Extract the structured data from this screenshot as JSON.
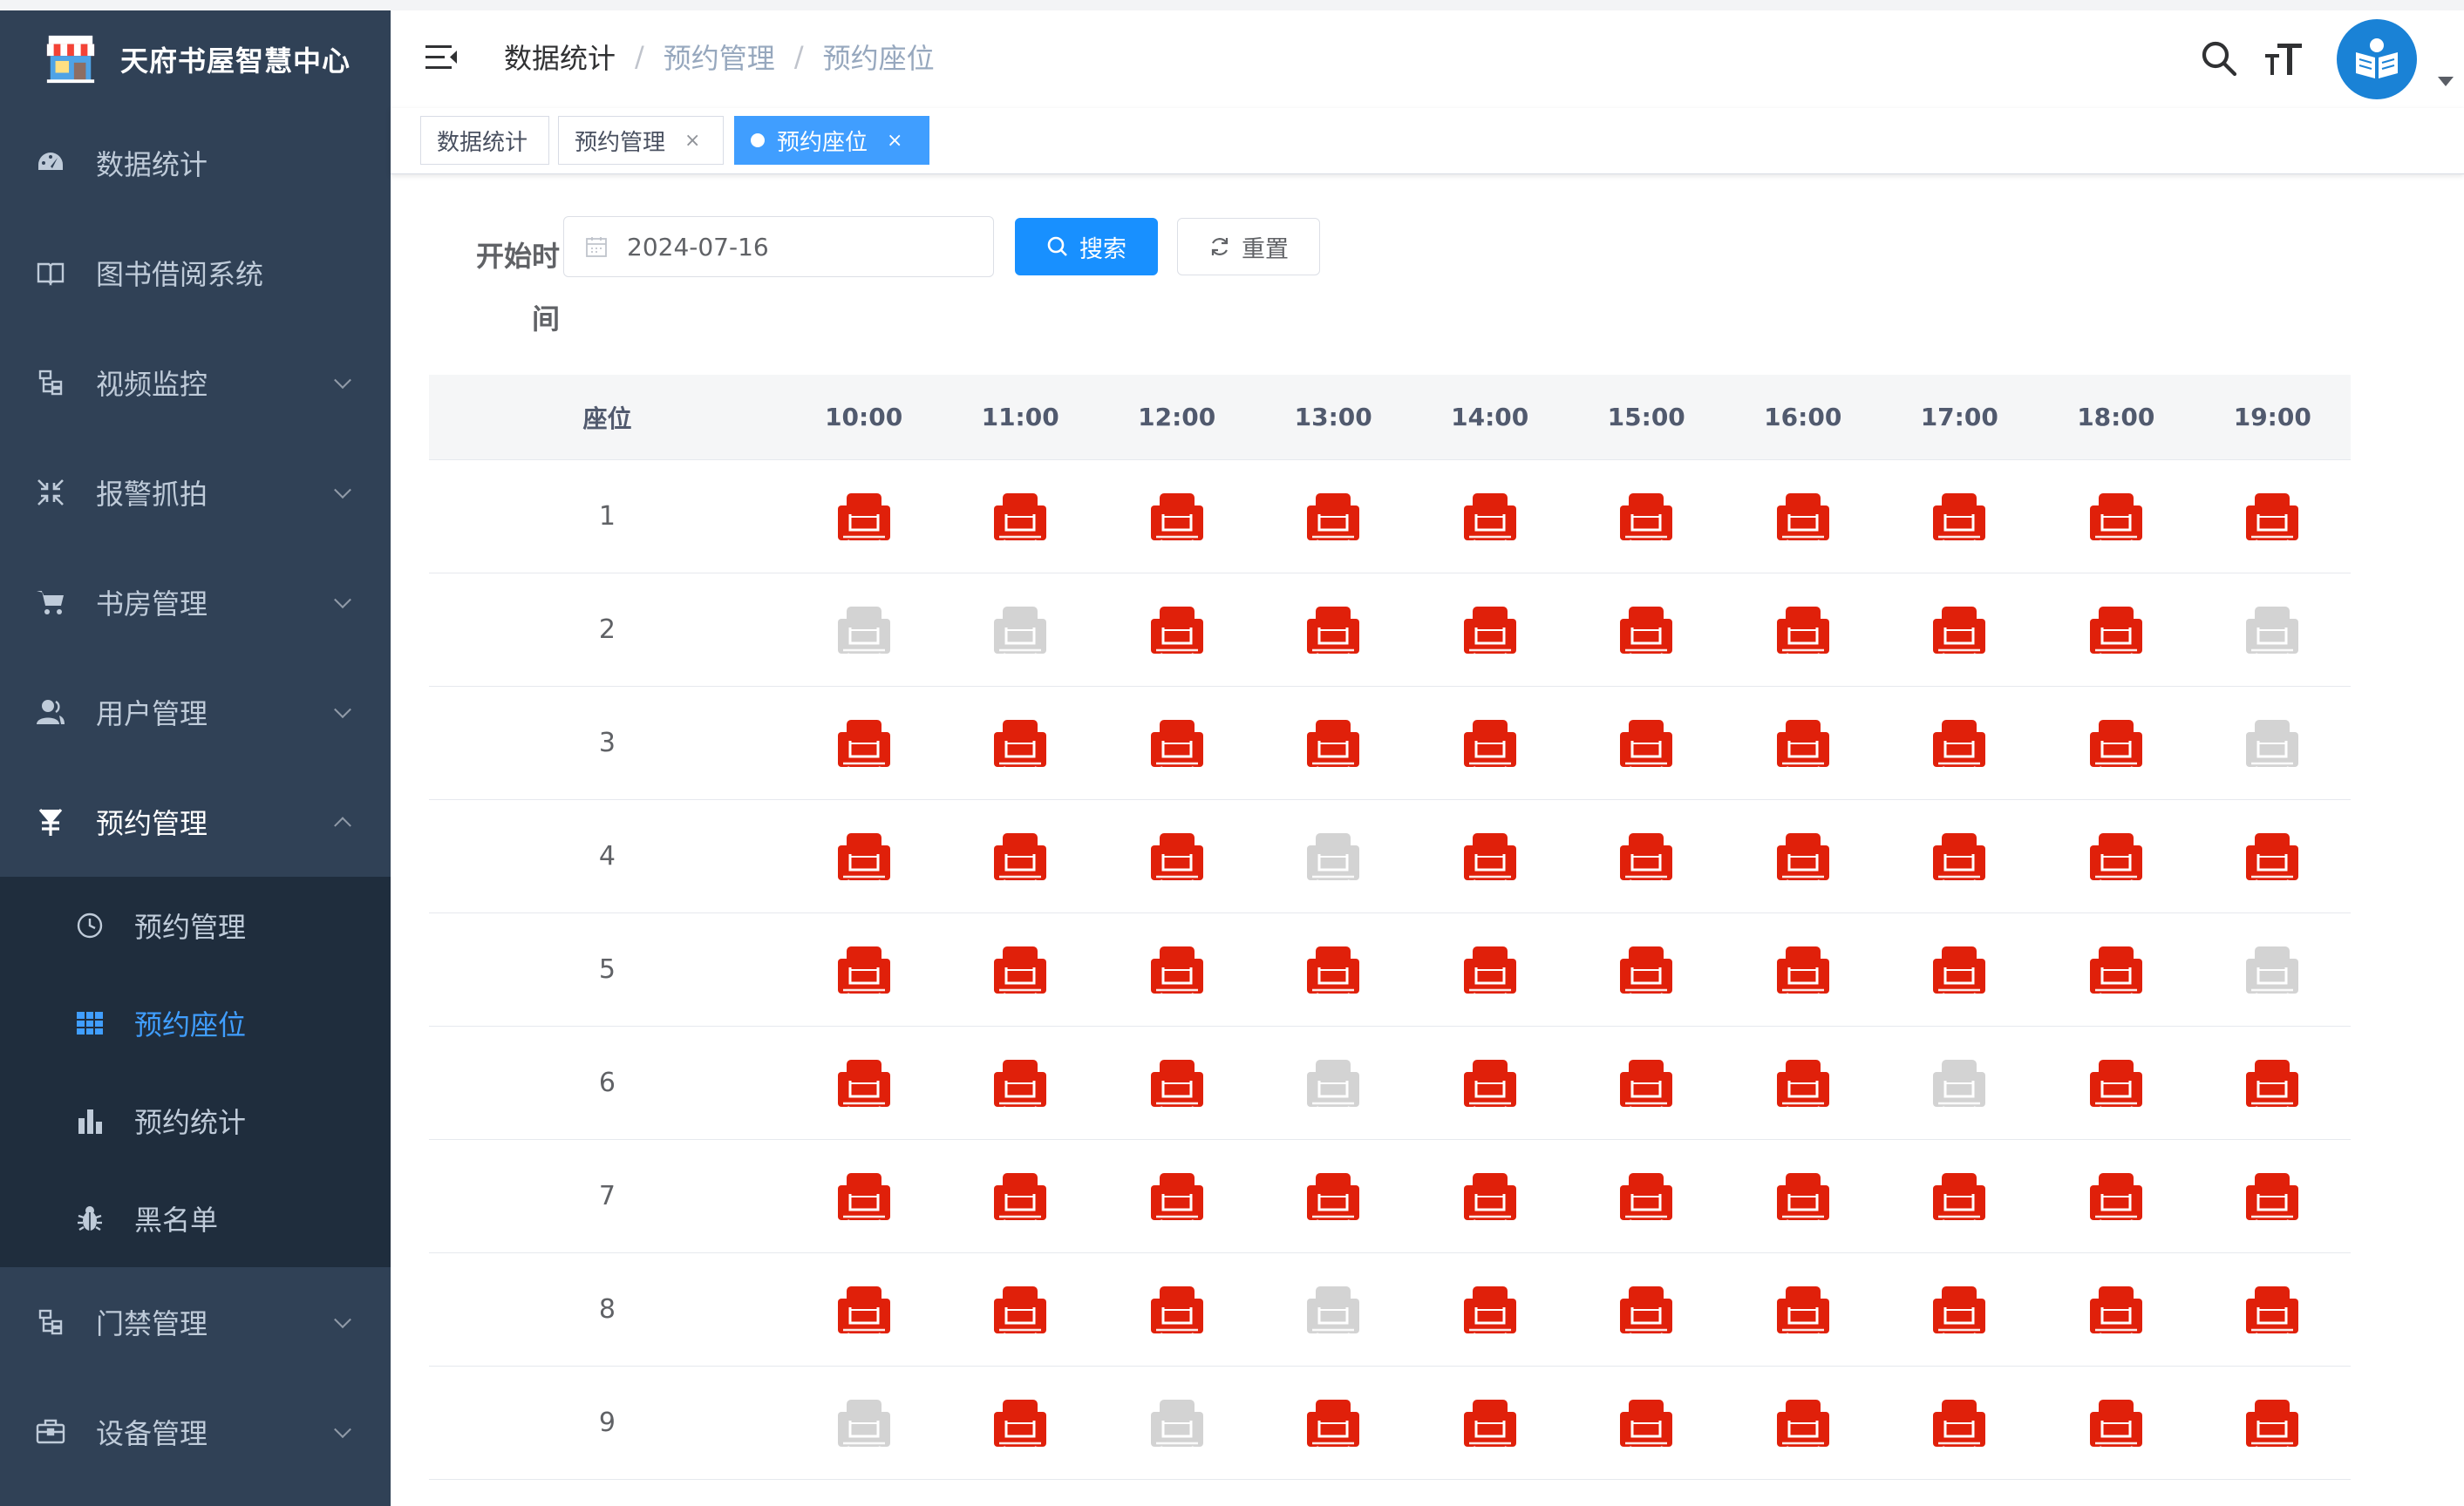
{
  "app": {
    "title": "天府书屋智慧中心"
  },
  "sidebar": {
    "items": [
      {
        "label": "数据统计",
        "icon": "dashboard-icon"
      },
      {
        "label": "图书借阅系统",
        "icon": "book-icon"
      },
      {
        "label": "视频监控",
        "icon": "tree-icon"
      },
      {
        "label": "报警抓拍",
        "icon": "compress-icon"
      },
      {
        "label": "书房管理",
        "icon": "cart-icon"
      },
      {
        "label": "用户管理",
        "icon": "user-icon"
      },
      {
        "label": "预约管理",
        "icon": "yen-icon"
      }
    ],
    "submenu": [
      {
        "label": "预约管理",
        "icon": "clock-icon"
      },
      {
        "label": "预约座位",
        "icon": "grid-icon"
      },
      {
        "label": "预约统计",
        "icon": "bar-chart-icon"
      },
      {
        "label": "黑名单",
        "icon": "bug-icon"
      }
    ],
    "after": [
      {
        "label": "门禁管理",
        "icon": "tree-icon"
      },
      {
        "label": "设备管理",
        "icon": "briefcase-icon"
      }
    ]
  },
  "breadcrumb": [
    "数据统计",
    "预约管理",
    "预约座位"
  ],
  "tags": [
    {
      "label": "数据统计"
    },
    {
      "label": "预约管理"
    },
    {
      "label": "预约座位"
    }
  ],
  "tag_close": "×",
  "form": {
    "label_line1": "开始时",
    "label_line2": "间",
    "date_value": "2024-07-16",
    "search_label": "搜索",
    "reset_label": "重置"
  },
  "colors": {
    "reserved": "#e0200a",
    "available": "#d3d3d3",
    "active": "#409eff",
    "sidebar_bg": "#304156"
  },
  "table": {
    "seat_header": "座位",
    "times": [
      "10:00",
      "11:00",
      "12:00",
      "13:00",
      "14:00",
      "15:00",
      "16:00",
      "17:00",
      "18:00",
      "19:00"
    ],
    "legend": {
      "1": "reserved (red)",
      "0": "available (grey)"
    },
    "rows": [
      {
        "seat": "1",
        "status": [
          1,
          1,
          1,
          1,
          1,
          1,
          1,
          1,
          1,
          1
        ]
      },
      {
        "seat": "2",
        "status": [
          0,
          0,
          1,
          1,
          1,
          1,
          1,
          1,
          1,
          0
        ]
      },
      {
        "seat": "3",
        "status": [
          1,
          1,
          1,
          1,
          1,
          1,
          1,
          1,
          1,
          0
        ]
      },
      {
        "seat": "4",
        "status": [
          1,
          1,
          1,
          0,
          1,
          1,
          1,
          1,
          1,
          1
        ]
      },
      {
        "seat": "5",
        "status": [
          1,
          1,
          1,
          1,
          1,
          1,
          1,
          1,
          1,
          0
        ]
      },
      {
        "seat": "6",
        "status": [
          1,
          1,
          1,
          0,
          1,
          1,
          1,
          0,
          1,
          1
        ]
      },
      {
        "seat": "7",
        "status": [
          1,
          1,
          1,
          1,
          1,
          1,
          1,
          1,
          1,
          1
        ]
      },
      {
        "seat": "8",
        "status": [
          1,
          1,
          1,
          0,
          1,
          1,
          1,
          1,
          1,
          1
        ]
      },
      {
        "seat": "9",
        "status": [
          0,
          1,
          0,
          1,
          1,
          1,
          1,
          1,
          1,
          1
        ]
      }
    ]
  }
}
